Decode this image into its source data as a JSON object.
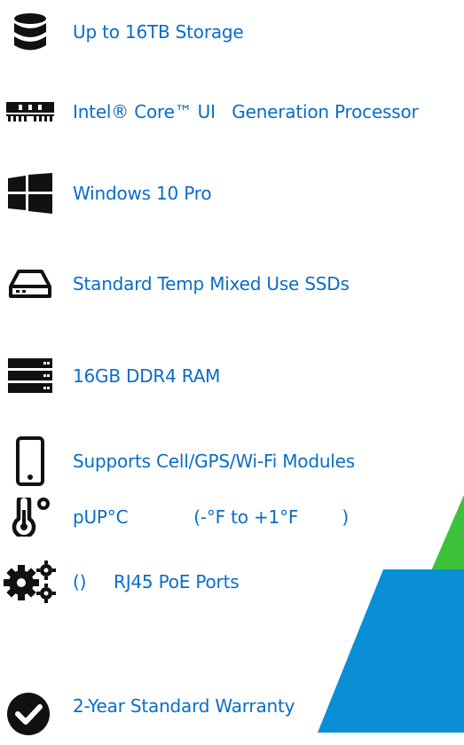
{
  "colors": {
    "accent_text": "#0a6cc7",
    "icon": "#111111",
    "decor_green": "#3cc13b",
    "decor_blue": "#0a8fd6"
  },
  "features": [
    {
      "icon": "database-icon",
      "label": "Up to 16TB Storage"
    },
    {
      "icon": "memory-chip-icon",
      "label": "Intel® Core™ UI   Generation Processor"
    },
    {
      "icon": "windows-logo-icon",
      "label": "Windows 10 Pro"
    },
    {
      "icon": "hard-drive-icon",
      "label": "Standard Temp Mixed Use SSDs"
    },
    {
      "icon": "server-icon",
      "label": "16GB DDR4 RAM"
    },
    {
      "icon": "mobile-phone-icon",
      "label": "Supports Cell/GPS/Wi-Fi Modules"
    },
    {
      "icon": "thermometer-icon",
      "label": "pUP°C            (-°F to +1°F        )"
    },
    {
      "icon": "gears-icon",
      "label": "()     RJ45 PoE Ports"
    },
    {
      "icon": "check-circle-icon",
      "label": "2-Year Standard Warranty"
    }
  ]
}
